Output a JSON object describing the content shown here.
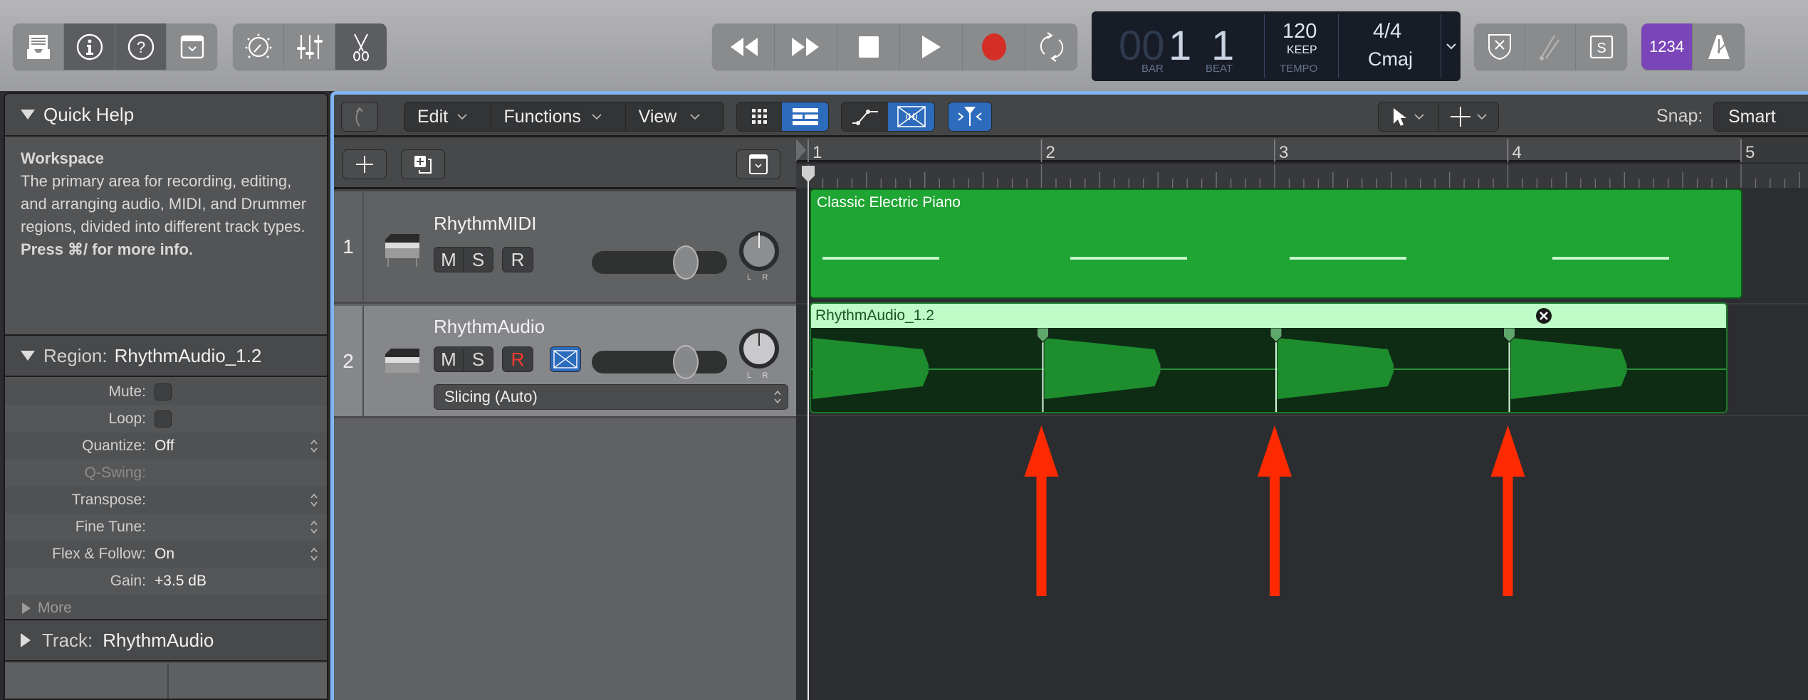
{
  "control_bar": {
    "view_buttons": [
      {
        "name": "library-icon",
        "active": false
      },
      {
        "name": "inspector-icon",
        "active": true
      },
      {
        "name": "quick-help-icon",
        "active": true
      },
      {
        "name": "toolbar-icon",
        "active": false
      }
    ],
    "edit_buttons": [
      {
        "name": "smart-controls-icon",
        "active": false
      },
      {
        "name": "mixer-icon",
        "active": false
      },
      {
        "name": "editors-icon",
        "active": true
      }
    ],
    "transport": [
      "rewind-icon",
      "fast-forward-icon",
      "stop-icon",
      "play-icon",
      "record-icon",
      "cycle-icon"
    ],
    "lcd": {
      "bar_dim": "00",
      "bar": "1",
      "beat": "1",
      "bar_label": "BAR",
      "beat_label": "BEAT",
      "tempo": "120",
      "tempo_mode": "KEEP",
      "tempo_label": "TEMPO",
      "signature": "4/4",
      "key": "Cmaj"
    },
    "right_buttons": [
      "replace-icon",
      "tuner-icon",
      "solo-icon"
    ],
    "count_in_label": "1234",
    "count_in_color": "#7a45b8",
    "metronome": "metronome-icon"
  },
  "inspector": {
    "quick_help": {
      "title": "Quick Help",
      "heading": "Workspace",
      "body": "The primary area for recording, editing, and arranging audio, MIDI, and Drummer regions, divided into different track types.",
      "hint": "Press ⌘/ for more info."
    },
    "region": {
      "label": "Region:",
      "name": "RhythmAudio_1.2",
      "rows": [
        {
          "key": "Mute:",
          "type": "checkbox",
          "value": ""
        },
        {
          "key": "Loop:",
          "type": "checkbox",
          "value": ""
        },
        {
          "key": "Quantize:",
          "type": "popup",
          "value": "Off"
        },
        {
          "key": "Q-Swing:",
          "type": "disabled",
          "value": ""
        },
        {
          "key": "Transpose:",
          "type": "popup",
          "value": ""
        },
        {
          "key": "Fine Tune:",
          "type": "popup",
          "value": ""
        },
        {
          "key": "Flex & Follow:",
          "type": "popup",
          "value": "On"
        },
        {
          "key": "Gain:",
          "type": "text",
          "value": "+3.5 dB"
        }
      ],
      "more_label": "More"
    },
    "track": {
      "label": "Track:",
      "name": "RhythmAudio"
    }
  },
  "arrange_toolbar": {
    "menus": [
      "Edit",
      "Functions",
      "View"
    ],
    "snap_label": "Snap:",
    "snap_value": "Smart"
  },
  "tracks": [
    {
      "number": "1",
      "name": "RhythmMIDI",
      "mute": "M",
      "solo": "S",
      "rec": "R",
      "rec_armed": false,
      "flex": false,
      "flex_mode": ""
    },
    {
      "number": "2",
      "name": "RhythmAudio",
      "mute": "M",
      "solo": "S",
      "rec": "R",
      "rec_armed": true,
      "flex": true,
      "flex_mode": "Slicing (Auto)"
    }
  ],
  "ruler": {
    "bars": [
      "1",
      "2",
      "3",
      "4",
      "5"
    ]
  },
  "regions": {
    "midi": {
      "name": "Classic Electric Piano",
      "color": "#1fa533"
    },
    "audio": {
      "name": "RhythmAudio_1.2",
      "color": "#bdfcc7",
      "flex_markers_at_bar": [
        2,
        3,
        4
      ]
    }
  },
  "annotations": {
    "arrow_color": "#ff2a00",
    "arrow_count": 3
  }
}
